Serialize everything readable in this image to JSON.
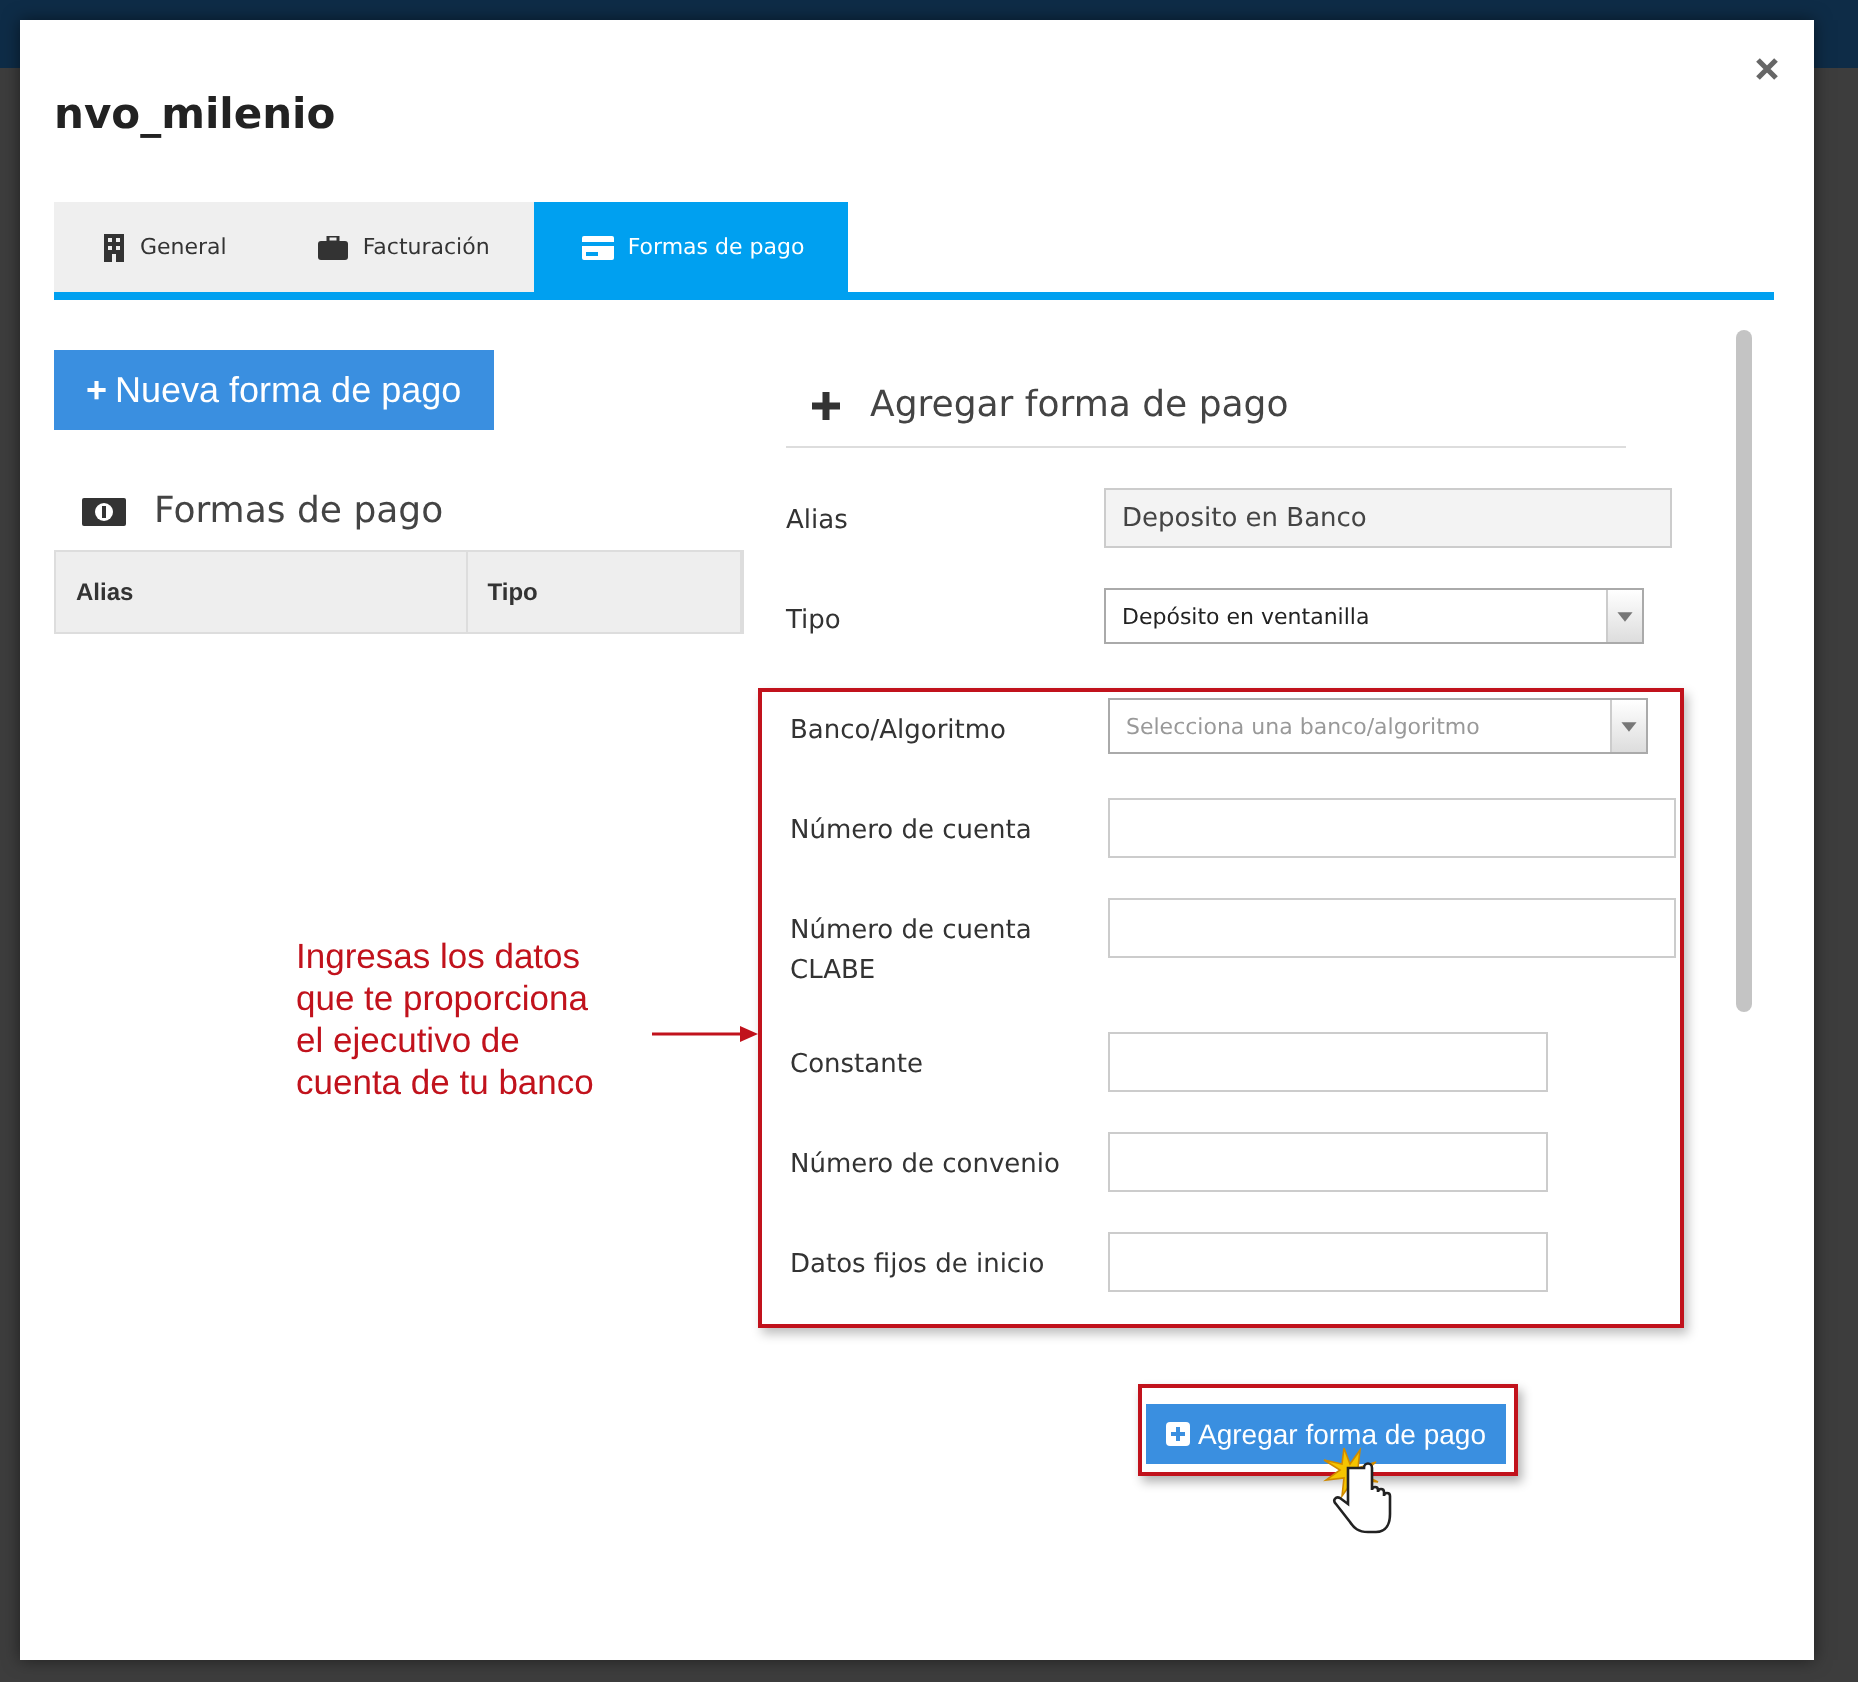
{
  "dialog": {
    "title": "nvo_milenio"
  },
  "tabs": [
    {
      "label": "General",
      "kind": "building",
      "selected": false
    },
    {
      "label": "Facturación",
      "kind": "briefcase",
      "selected": false
    },
    {
      "label": "Formas de pago",
      "kind": "card",
      "selected": true
    }
  ],
  "new_button": {
    "icon": "+",
    "label": "Nueva forma de pago"
  },
  "list": {
    "title": "Formas de pago",
    "columns": [
      "Alias",
      "Tipo"
    ]
  },
  "form": {
    "title": "Agregar forma de pago",
    "fields": [
      {
        "label": "Alias",
        "kind": "text",
        "value": "Deposito en Banco",
        "highlighted": false
      },
      {
        "label": "Tipo",
        "kind": "select",
        "value": "Depósito en ventanilla",
        "highlighted": false
      },
      {
        "label": "Banco/Algoritmo",
        "kind": "select",
        "placeholder": "Selecciona una banco/algoritmo",
        "highlighted": true
      },
      {
        "label": "Número de cuenta",
        "kind": "text",
        "highlighted": true
      },
      {
        "label": "Número de cuenta CLABE",
        "kind": "text",
        "highlighted": true
      },
      {
        "label": "Constante",
        "kind": "short",
        "highlighted": true
      },
      {
        "label": "Número de convenio",
        "kind": "short",
        "highlighted": true
      },
      {
        "label": "Datos fijos de inicio",
        "kind": "short",
        "highlighted": true
      }
    ],
    "submit": {
      "label": "Agregar forma de pago"
    }
  },
  "annotation": {
    "text": "Ingresas los datos\nque te proporciona\nel ejecutivo de\ncuenta de tu banco"
  }
}
